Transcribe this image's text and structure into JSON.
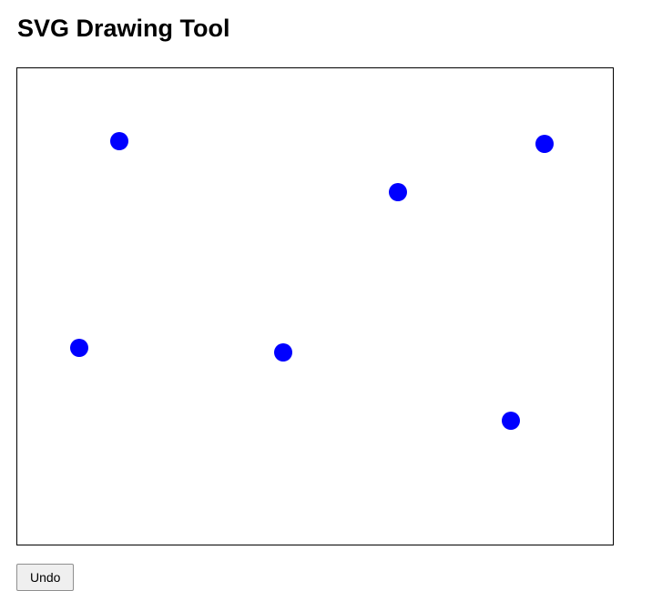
{
  "page": {
    "title": "SVG Drawing Tool"
  },
  "toolbar": {
    "undo_label": "Undo"
  },
  "drawing": {
    "shape": "circle",
    "fill_color": "#0000ff",
    "border_color": "#000000"
  }
}
